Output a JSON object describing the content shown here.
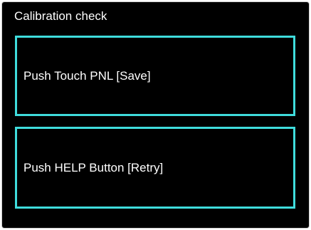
{
  "screen": {
    "title": "Calibration check",
    "background_color": "#000000",
    "text_color": "#ffffff",
    "accent_color": "#3fdcdc"
  },
  "options": [
    {
      "label": "Push Touch PNL [Save]"
    },
    {
      "label": "Push HELP Button [Retry]"
    }
  ]
}
